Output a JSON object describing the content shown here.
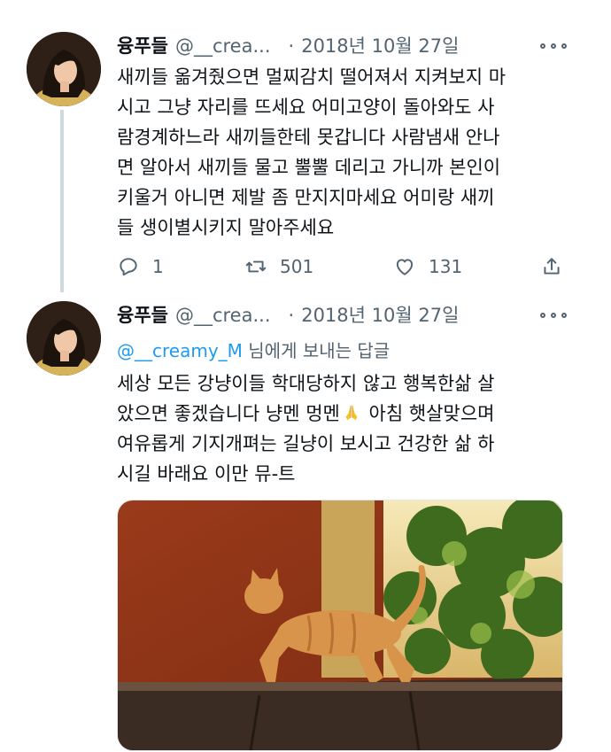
{
  "tweets": [
    {
      "display_name": "융푸들",
      "handle": "@__crea...",
      "separator": "·",
      "date": "2018년 10월 27일",
      "text_lines": [
        "새끼들 옮겨줬으면 멀찌감치 떨어져서 지켜보지 마",
        "시고 그냥 자리를 뜨세요 어미고양이 돌아와도 사",
        "람경계하느라 새끼들한테 못갑니다 사람냄새 안나",
        "면 알아서 새끼들 물고 뿔뿔 데리고 가니까 본인이",
        "키울거 아니면 제발 좀 만지지마세요 어미랑 새끼",
        "들 생이별시키지 말아주세요"
      ],
      "reply_count": "1",
      "retweet_count": "501",
      "like_count": "131"
    },
    {
      "display_name": "융푸들",
      "handle": "@__crea...",
      "separator": "·",
      "date": "2018년 10월 27일",
      "reply_to_mention": "@__creamy_M",
      "reply_to_suffix": " 님에게 보내는 답글",
      "text_lines": [
        "세상 모든 강냥이들 학대당하지 않고 행복한삶 살",
        "았으면 좋겠습니다 냥멘 멍멘",
        "여유롭게 기지개펴는 길냥이 보시고 건강한 삶 하",
        "시길 바래요 이만 뮤-트"
      ],
      "line2_after_emoji": " 아침 햇살맞으며",
      "emoji": "folded-hands",
      "media": "orange-tabby-cat-stretching-on-wall-photo"
    }
  ],
  "colors": {
    "secondary_text": "#536471",
    "link": "#1d9bf0",
    "thread_line": "#cfd9de"
  }
}
